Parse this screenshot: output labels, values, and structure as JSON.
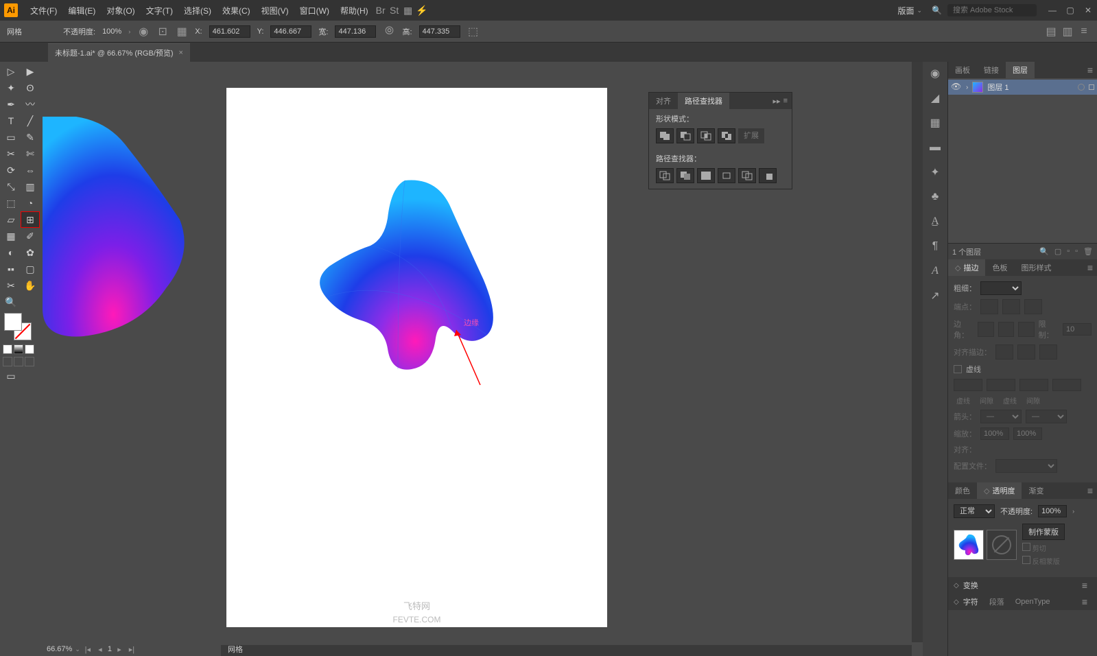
{
  "app": {
    "logo": "Ai"
  },
  "menu": {
    "file": "文件(F)",
    "edit": "编辑(E)",
    "object": "对象(O)",
    "type": "文字(T)",
    "select": "选择(S)",
    "effect": "效果(C)",
    "view": "视图(V)",
    "window": "窗口(W)",
    "help": "帮助(H)"
  },
  "workspace_label": "版面",
  "search_placeholder": "搜索 Adobe Stock",
  "control": {
    "selection_label": "网格",
    "opacity_label": "不透明度:",
    "opacity_value": "100%",
    "x_label": "X:",
    "x_value": "461.602",
    "y_label": "Y:",
    "y_value": "446.667",
    "w_label": "宽:",
    "w_value": "447.136",
    "h_label": "高:",
    "h_value": "447.335"
  },
  "tab": {
    "title": "未标题-1.ai* @ 66.67% (RGB/预览)"
  },
  "status": {
    "zoom": "66.67%",
    "page": "1",
    "mode": "网格"
  },
  "pathfinder": {
    "tab_align": "对齐",
    "tab_pathfinder": "路径查找器",
    "shape_modes": "形状模式：",
    "pathfinder_label": "路径查找器：",
    "expand": "扩展"
  },
  "layers_panel": {
    "tab_artboards": "画板",
    "tab_links": "链接",
    "tab_layers": "图层",
    "layer_name": "图层 1",
    "count": "1 个图层"
  },
  "stroke_panel": {
    "tab_stroke": "描边",
    "tab_swatches": "色板",
    "tab_styles": "图形样式",
    "weight_label": "粗细：",
    "cap_label": "端点：",
    "corner_label": "边角：",
    "limit_label": "限制：",
    "limit_value": "10",
    "align_label": "对齐描边：",
    "dashed": "虚线",
    "dash": "虚线",
    "gap": "间隙",
    "arrow_label": "箭头：",
    "scale_label": "缩放：",
    "scale_value": "100%",
    "align_arrow": "对齐：",
    "profile": "配置文件："
  },
  "color_panel": {
    "tab_color": "颜色",
    "tab_transparency": "透明度",
    "tab_gradient": "渐变"
  },
  "transparency": {
    "blend": "正常",
    "opacity_label": "不透明度:",
    "opacity_value": "100%",
    "make_mask": "制作蒙版",
    "clip": "剪切",
    "invert": "反相蒙版"
  },
  "transform_panel": "变换",
  "char_panel": {
    "tab_char": "字符",
    "tab_para": "段落",
    "tab_ot": "OpenType"
  },
  "canvas": {
    "annotation": "边缘",
    "watermark1": "飞特网",
    "watermark2": "FEVTE.COM"
  }
}
